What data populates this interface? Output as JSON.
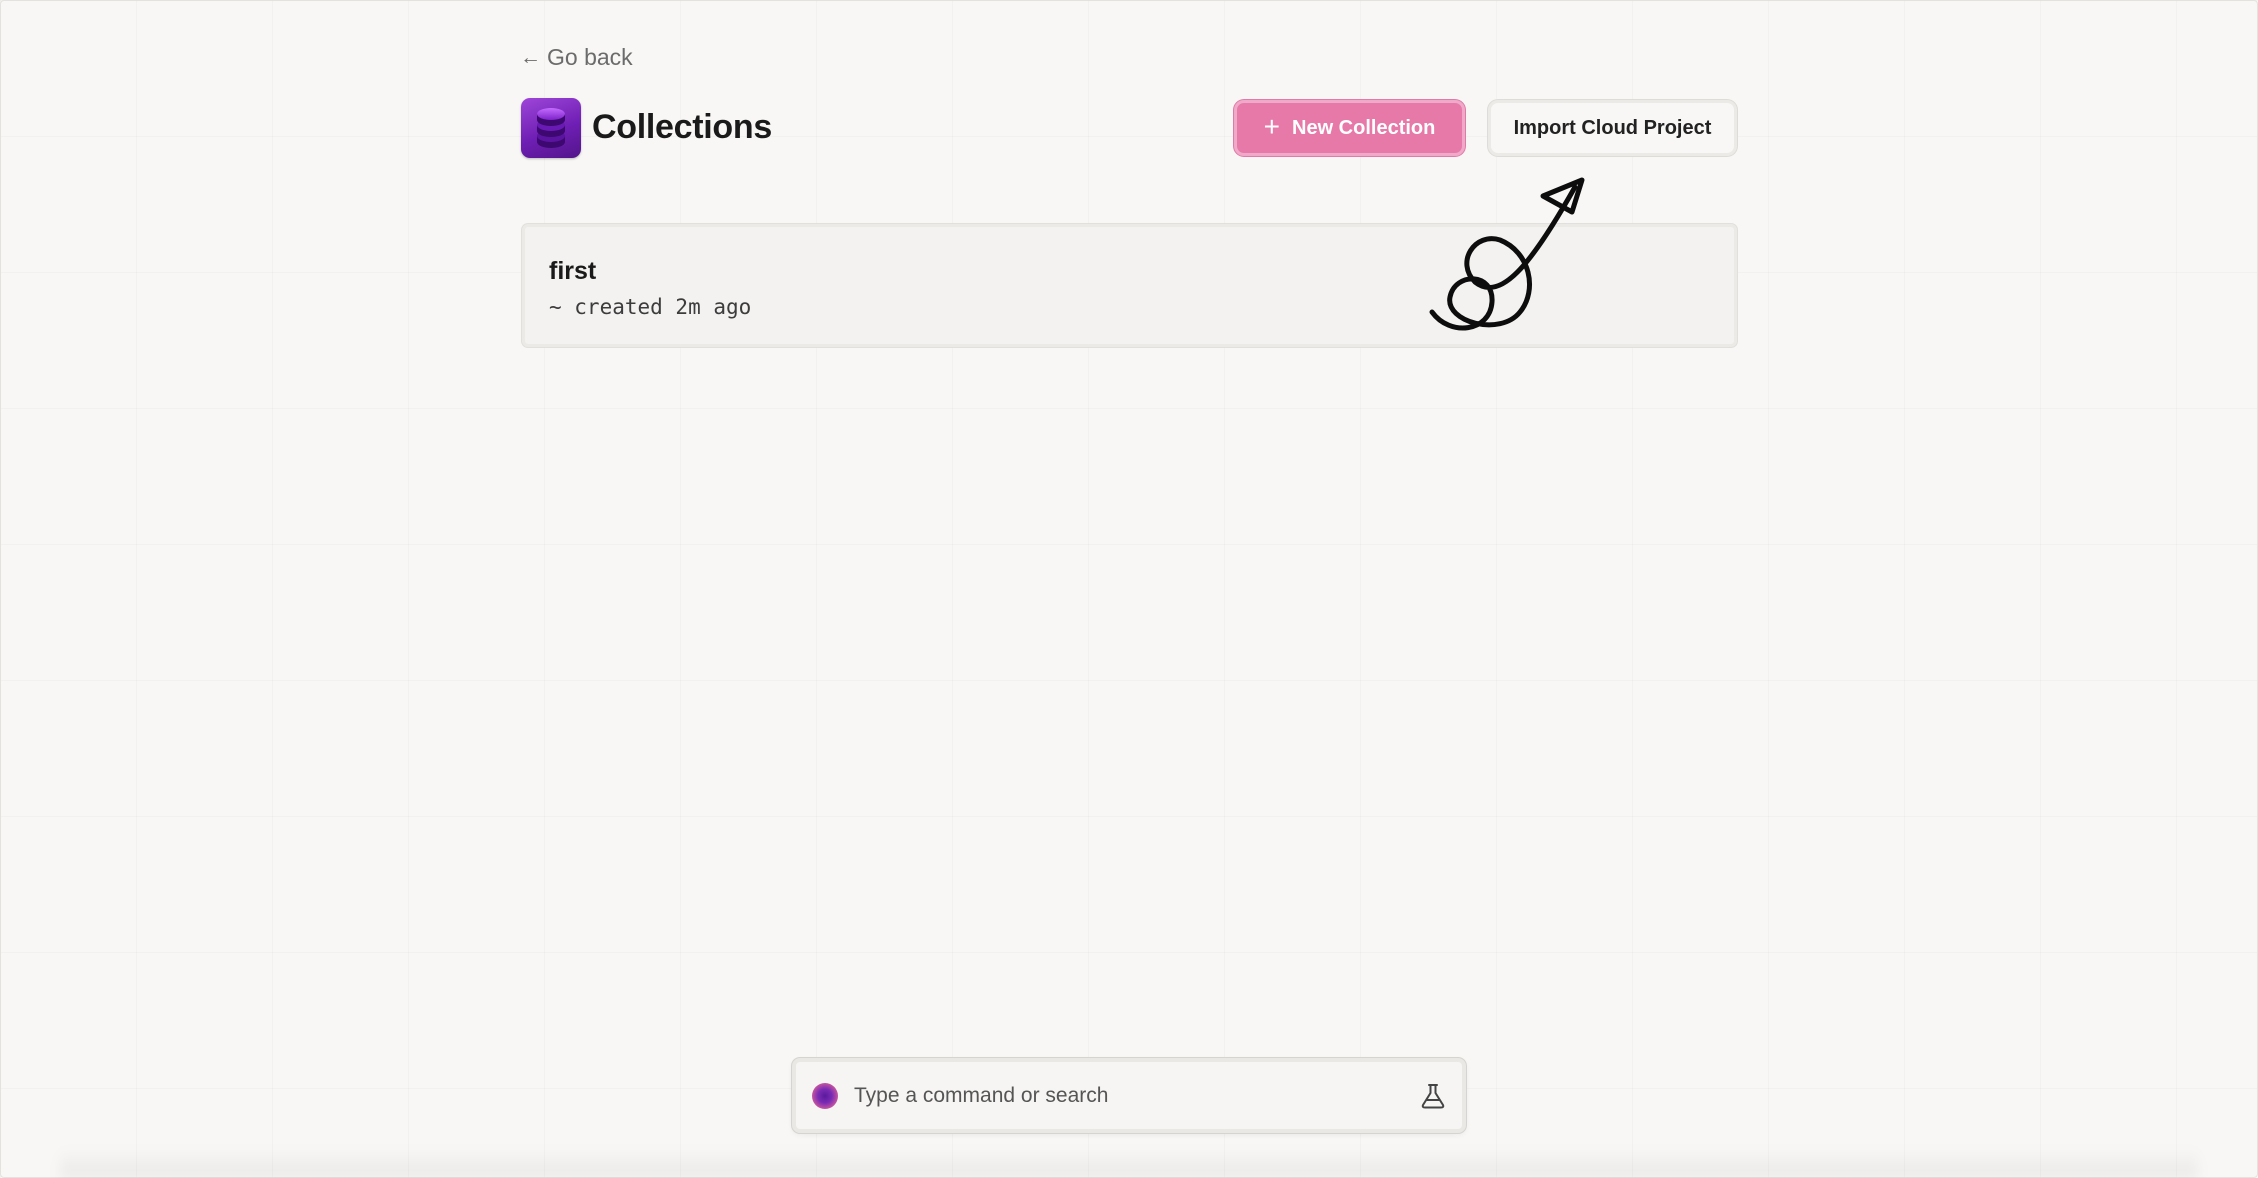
{
  "nav": {
    "back_arrow_icon": "arrow-left",
    "back_label": "Go back"
  },
  "header": {
    "title": "Collections",
    "icon": "database-stack-icon",
    "icon_color": "#7a1fc4"
  },
  "actions": {
    "new_collection_label": "New Collection",
    "new_collection_icon": "plus-icon",
    "new_collection_color": "#e779a8",
    "import_label": "Import Cloud Project"
  },
  "collections": [
    {
      "name": "first",
      "meta": "~ created 2m ago"
    }
  ],
  "command_bar": {
    "placeholder": "Type a command or search",
    "left_icon": "assistant-orb-icon",
    "right_icon": "flask-icon"
  }
}
